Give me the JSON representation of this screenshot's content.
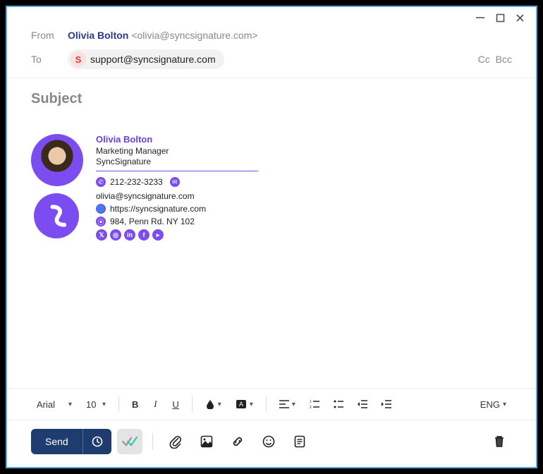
{
  "header": {
    "from_label": "From",
    "from_name": "Olivia Bolton",
    "from_email": "<olivia@syncsignature.com>",
    "to_label": "To",
    "to_chip_initial": "S",
    "to_chip_email": "support@syncsignature.com",
    "cc_label": "Cc",
    "bcc_label": "Bcc"
  },
  "subject": {
    "placeholder": "Subject",
    "value": ""
  },
  "signature": {
    "name": "Olivia Bolton",
    "title": "Marketing Manager",
    "company": "SyncSignature",
    "phone": "212-232-3233",
    "email": "olivia@syncsignature.com",
    "website": "https://syncsignature.com",
    "address": "984, Penn Rd. NY 102",
    "socials": [
      "x",
      "instagram",
      "linkedin",
      "facebook",
      "youtube"
    ]
  },
  "format": {
    "font": "Arial",
    "size": "10",
    "lang": "ENG"
  },
  "actions": {
    "send": "Send"
  }
}
